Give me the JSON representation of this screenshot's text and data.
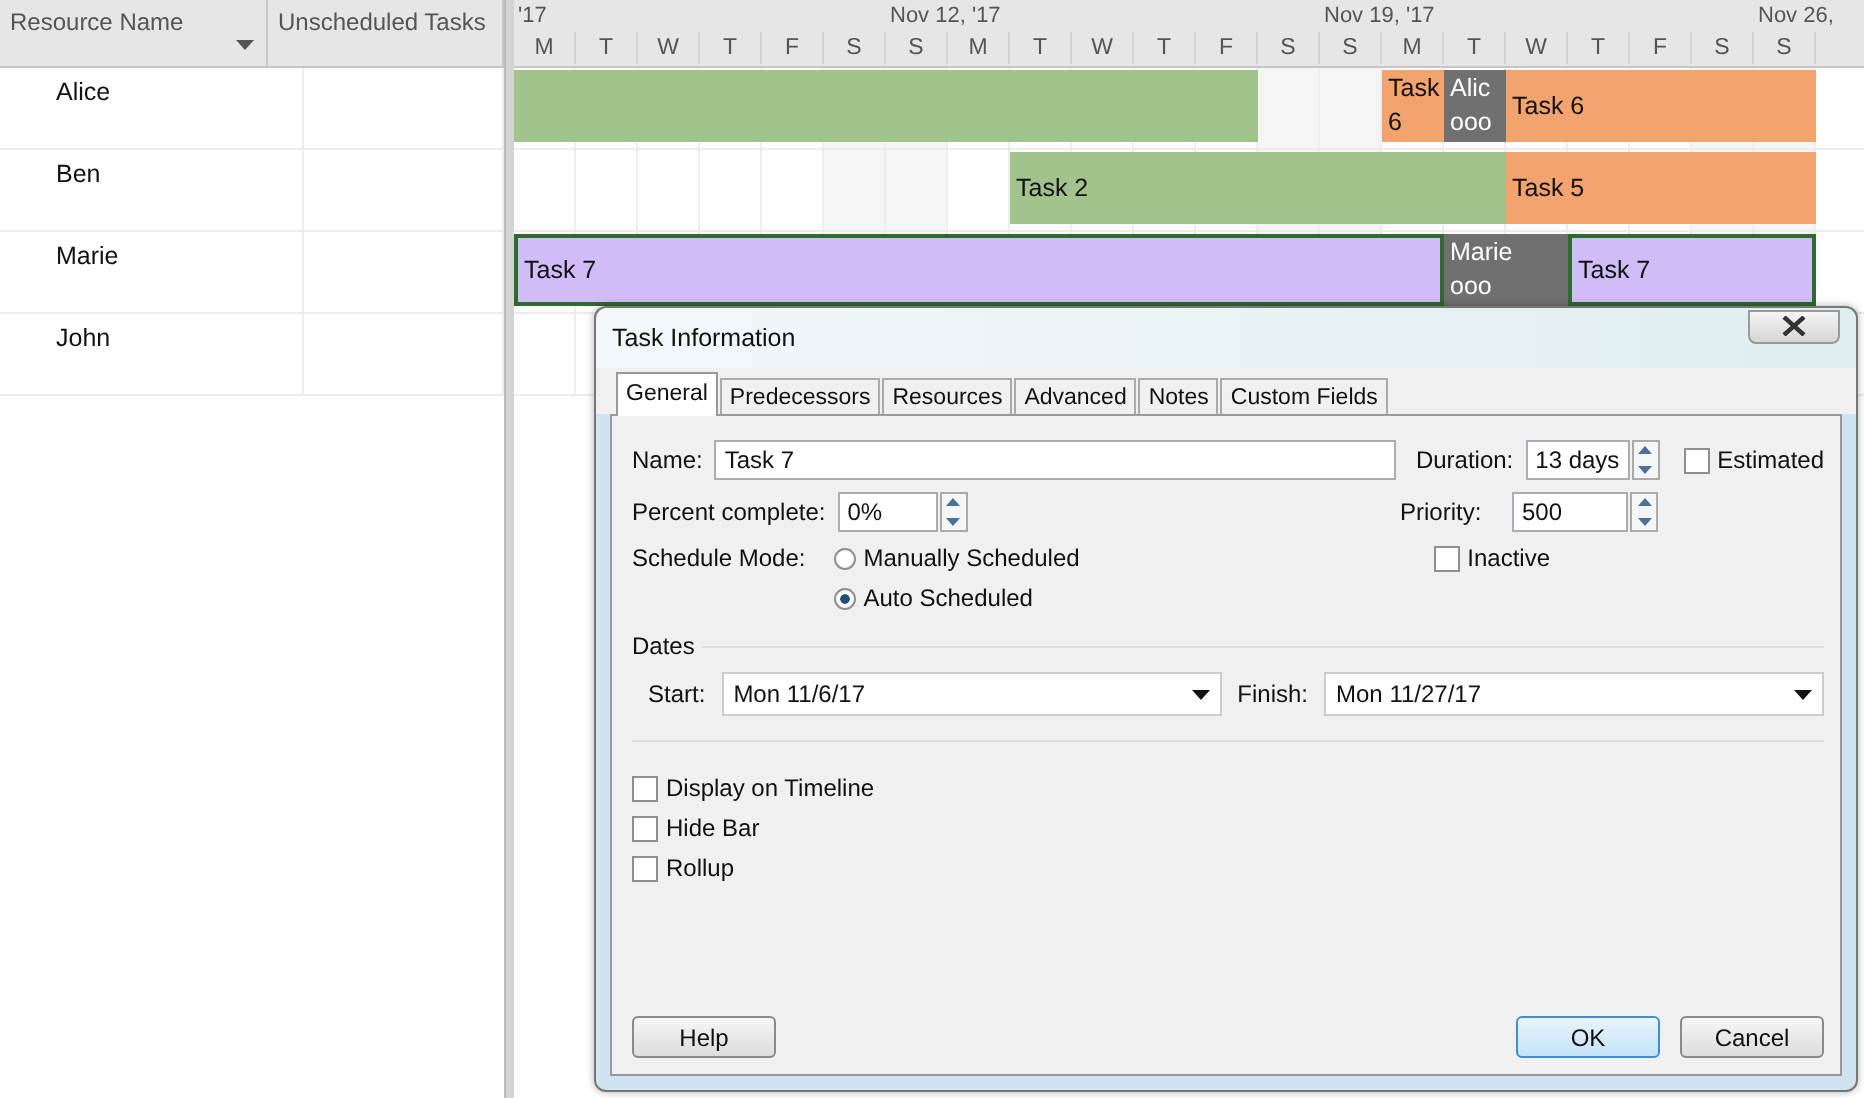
{
  "table": {
    "columns": [
      {
        "label": "Resource Name"
      },
      {
        "label": "Unscheduled Tasks"
      }
    ],
    "rows": [
      {
        "name": "Alice"
      },
      {
        "name": "Ben"
      },
      {
        "name": "Marie"
      },
      {
        "name": "John"
      }
    ]
  },
  "timescale": {
    "weeks": [
      {
        "label": "'17"
      },
      {
        "label": "Nov 12, '17"
      },
      {
        "label": "Nov 19, '17"
      },
      {
        "label": "Nov 26,"
      }
    ],
    "days": [
      "M",
      "T",
      "W",
      "T",
      "F",
      "S",
      "S",
      "M",
      "T",
      "W",
      "T",
      "F",
      "S",
      "S",
      "M",
      "T",
      "W",
      "T",
      "F",
      "S",
      "S"
    ]
  },
  "gantt_rows": [
    {
      "bars": [
        {
          "color": "#a2c48c",
          "selected": false
        },
        {
          "lines": [
            "Task",
            "6"
          ],
          "color": "#f2a36e",
          "selected": false
        },
        {
          "lines": [
            "Alic",
            "ooo"
          ],
          "color": "#707070",
          "selected": false
        },
        {
          "lines": [
            "Task 6"
          ],
          "color": "#f2a36e",
          "selected": false
        }
      ]
    },
    {
      "bars": [
        {
          "lines": [
            "Task 2"
          ],
          "color": "#a2c48c",
          "selected": false
        },
        {
          "lines": [
            "Task 5"
          ],
          "color": "#f2a36e",
          "selected": false
        }
      ]
    },
    {
      "bars": [
        {
          "lines": [
            "Task 7"
          ],
          "color": "#d0bcf6",
          "selected": true
        },
        {
          "lines": [
            "Marie",
            "ooo"
          ],
          "color": "#707070",
          "selected": false
        },
        {
          "lines": [
            "Task 7"
          ],
          "color": "#d0bcf6",
          "selected": true
        }
      ]
    },
    {
      "bars": []
    }
  ],
  "dialog": {
    "title": "Task Information",
    "tabs": [
      {
        "label": "General",
        "selected": true
      },
      {
        "label": "Predecessors",
        "selected": false
      },
      {
        "label": "Resources",
        "selected": false
      },
      {
        "label": "Advanced",
        "selected": false
      },
      {
        "label": "Notes",
        "selected": false
      },
      {
        "label": "Custom Fields",
        "selected": false
      }
    ],
    "name": {
      "label": "Name:",
      "value": "Task 7"
    },
    "duration": {
      "label": "Duration:",
      "value": "13 days"
    },
    "estimated": {
      "label": "Estimated",
      "checked": false
    },
    "percent_complete": {
      "label": "Percent complete:",
      "value": "0%"
    },
    "priority": {
      "label": "Priority:",
      "value": "500"
    },
    "inactive": {
      "label": "Inactive",
      "checked": false
    },
    "schedule_mode": {
      "label": "Schedule Mode:",
      "options": [
        {
          "label": "Manually Scheduled",
          "selected": false
        },
        {
          "label": "Auto Scheduled",
          "selected": true
        }
      ]
    },
    "dates": {
      "label": "Dates",
      "start": {
        "label": "Start:",
        "value": "Mon 11/6/17"
      },
      "finish": {
        "label": "Finish:",
        "value": "Mon 11/27/17"
      }
    },
    "options": [
      {
        "label": "Display on Timeline",
        "checked": false
      },
      {
        "label": "Hide Bar",
        "checked": false
      },
      {
        "label": "Rollup",
        "checked": false
      }
    ],
    "buttons": {
      "help": "Help",
      "ok": "OK",
      "cancel": "Cancel"
    }
  }
}
